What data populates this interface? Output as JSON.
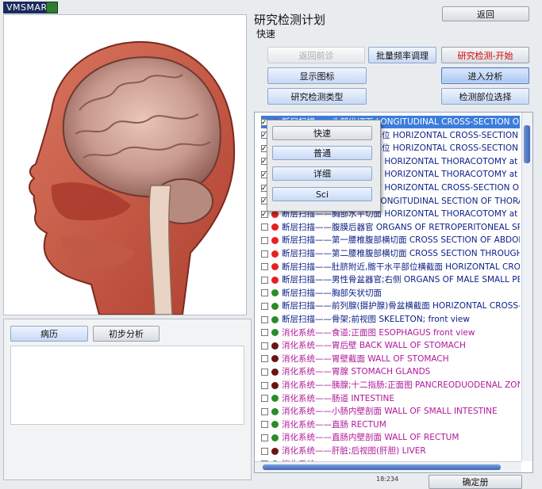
{
  "app": {
    "brand": "VMSMART"
  },
  "header": {
    "back_label": "返回"
  },
  "plan": {
    "title": "研究检测计划",
    "mode": "快速"
  },
  "buttons": {
    "back_up": "返回前诊",
    "batch_freq": "批量频率调理",
    "research_start": "研究检测-开始",
    "show_icons": "显示图标",
    "enter_analysis": "进入分析",
    "research_type": "研究检测类型",
    "select_part": "检测部位选择"
  },
  "popup": {
    "options": [
      "快速",
      "普通",
      "详细",
      "Sci"
    ]
  },
  "list_rows": [
    {
      "text": "断层扫描——头部纵切面 LONGITUDINAL CROSS-SECTION OF HEAD",
      "checked": true,
      "dot": "#e32222",
      "color": "#0a1e86",
      "selected": true
    },
    {
      "text": "断层扫描——头部横切面部位 HORIZONTAL CROSS-SECTION OF HEAD",
      "checked": true,
      "dot": "#e32222",
      "color": "#0a1e86"
    },
    {
      "text": "断层扫描——头部横切面部位 HORIZONTAL CROSS-SECTION OF HEAD",
      "checked": true,
      "dot": "#e32222",
      "color": "#0a1e86"
    },
    {
      "text": "断层扫描——胸部水平切面 HORIZONTAL THORACOTOMY at the level of ascending",
      "checked": true,
      "dot": "#e32222",
      "color": "#0a1e86"
    },
    {
      "text": "断层扫描——胸部水平切面 HORIZONTAL THORACOTOMY at the level of venae",
      "checked": true,
      "dot": "#e32222",
      "color": "#0a1e86"
    },
    {
      "text": "断层扫描——躯干水平切面 HORIZONTAL CROSS-SECTION OF TRUNK",
      "checked": true,
      "dot": "#e32222",
      "color": "#0a1e86"
    },
    {
      "text": "断层扫描——胸部纵切面 LONGITUDINAL SECTION OF THORAX AND",
      "checked": true,
      "dot": "#e32222",
      "color": "#0a1e86"
    },
    {
      "text": "断层扫描——胸部水平切面 HORIZONTAL THORACOTOMY at the level",
      "checked": true,
      "dot": "#e32222",
      "color": "#0a1e86"
    },
    {
      "text": "断层扫描——腹膜后器官 ORGANS OF RETROPERITONEAL SPACE",
      "checked": false,
      "dot": "#e32222",
      "color": "#0a1e86"
    },
    {
      "text": "断层扫描——第一腰椎腹部横切面 CROSS SECTION OF ABDOMEN at the level",
      "checked": false,
      "dot": "#e32222",
      "color": "#0a1e86"
    },
    {
      "text": "断层扫描——第二腰椎腹部横切面 CROSS SECTION THROUGH ABDOMEN at the",
      "checked": false,
      "dot": "#e32222",
      "color": "#0a1e86"
    },
    {
      "text": "断层扫描——肚脐附近,髂干水平部位横截面 HORIZONTAL CROSS-SECTION OF",
      "checked": false,
      "dot": "#e32222",
      "color": "#0a1e86"
    },
    {
      "text": "断层扫描——男性骨盆器官;右侧 ORGANS OF MALE SMALL PELVIS, right side",
      "checked": false,
      "dot": "#e32222",
      "color": "#0a1e86"
    },
    {
      "text": "断层扫描——胸部矢状切面",
      "checked": false,
      "dot": "#2a8c2a",
      "color": "#0a1e86"
    },
    {
      "text": "断层扫描——前列腺(摄护腺)骨盆横截面 HORIZONTAL CROSS-SECTION OF P",
      "checked": false,
      "dot": "#2a8c2a",
      "color": "#0a1e86"
    },
    {
      "text": "断层扫描——骨架;前视图 SKELETON; front view",
      "checked": false,
      "dot": "#2a8c2a",
      "color": "#0a1e86"
    },
    {
      "text": "消化系统——食道;正面图 ESOPHAGUS front view",
      "checked": false,
      "dot": "#2a8c2a",
      "color": "#b0179a"
    },
    {
      "text": "消化系统——胃后壁 BACK WALL OF STOMACH",
      "checked": false,
      "dot": "#6b1414",
      "color": "#b0179a"
    },
    {
      "text": "消化系统——胃壁截面 WALL OF STOMACH",
      "checked": false,
      "dot": "#6b1414",
      "color": "#b0179a"
    },
    {
      "text": "消化系统——胃腺 STOMACH GLANDS",
      "checked": false,
      "dot": "#6b1414",
      "color": "#b0179a"
    },
    {
      "text": "消化系统——胰腺;十二指肠;正面图 PANCREODUODENAL ZONE; front view",
      "checked": false,
      "dot": "#6b1414",
      "color": "#b0179a"
    },
    {
      "text": "消化系统——肠道 INTESTINE",
      "checked": false,
      "dot": "#2a8c2a",
      "color": "#b0179a"
    },
    {
      "text": "消化系统——小肠内壁剖面 WALL OF SMALL INTESTINE",
      "checked": false,
      "dot": "#2a8c2a",
      "color": "#b0179a"
    },
    {
      "text": "消化系统——直肠 RECTUM",
      "checked": false,
      "dot": "#2a8c2a",
      "color": "#b0179a"
    },
    {
      "text": "消化系统——直肠内壁剖面 WALL OF RECTUM",
      "checked": false,
      "dot": "#2a8c2a",
      "color": "#b0179a"
    },
    {
      "text": "消化系统——肝脏;后视图(肝胆) LIVER",
      "checked": false,
      "dot": "#6b1414",
      "color": "#b0179a"
    },
    {
      "text": "消化系统——",
      "checked": false,
      "dot": "#2a8c2a",
      "color": "#b0179a"
    }
  ],
  "tabs": {
    "history": "病历",
    "initial": "初步分析"
  },
  "status": {
    "time": "18:234"
  },
  "bottom": {
    "confirm_label": "确定册"
  }
}
